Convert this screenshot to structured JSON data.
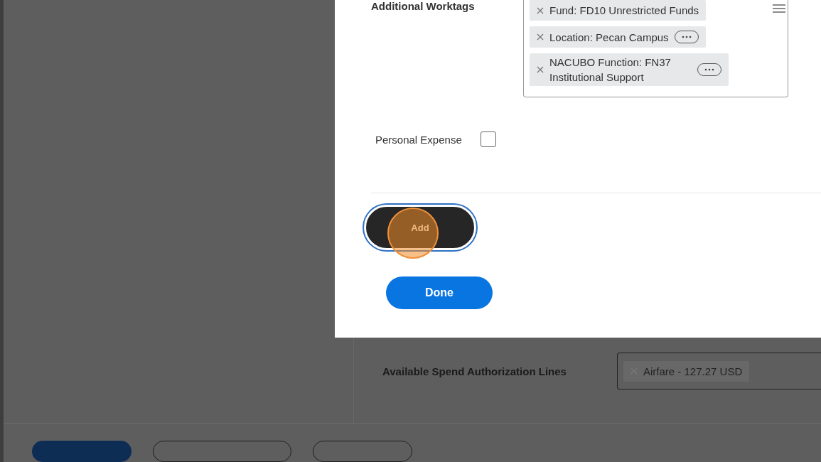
{
  "dialog": {
    "worktags": {
      "label": "Additional Worktags",
      "tags": [
        {
          "text": "Fund: FD10 Unrestricted Funds",
          "menu": false
        },
        {
          "text": "Location: Pecan Campus",
          "menu": true
        },
        {
          "text": "NACUBO Function: FN37 Institutional Support",
          "menu": true
        }
      ]
    },
    "personal_expense": {
      "label": "Personal Expense",
      "checked": false
    },
    "add_button": {
      "label": "Add",
      "focused": true,
      "click_marker": true
    },
    "done_button": {
      "label": "Done"
    }
  },
  "page": {
    "spend_lines": {
      "label": "Available Spend Authorization Lines",
      "tags": [
        {
          "text": "Airfare - 127.27 USD"
        }
      ]
    },
    "buttons": [
      {
        "kind": "primary"
      },
      {
        "kind": "secondary"
      },
      {
        "kind": "secondary"
      }
    ]
  }
}
